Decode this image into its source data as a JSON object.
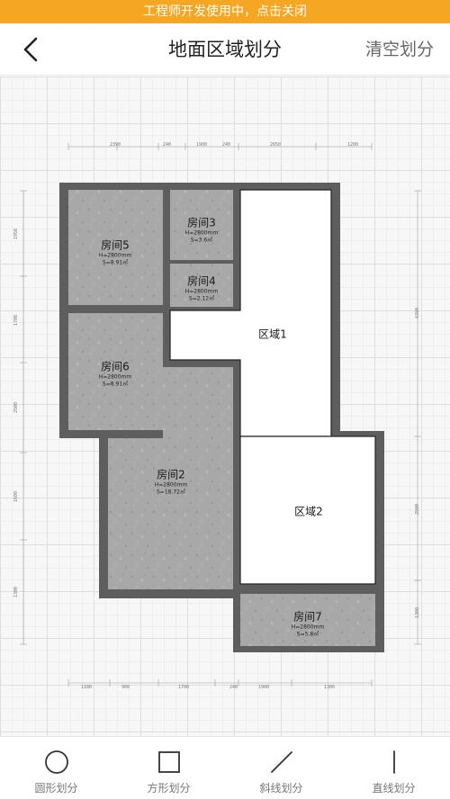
{
  "banner": {
    "text": "工程师开发使用中，点击关闭"
  },
  "header": {
    "title": "地面区域划分",
    "clear_label": "清空划分",
    "back_icon": "chevron-left-icon"
  },
  "plan": {
    "rooms": [
      {
        "id": "room5",
        "name": "房间5",
        "height": "H=2800mm",
        "area": "S=8.91㎡"
      },
      {
        "id": "room3",
        "name": "房间3",
        "height": "H=2800mm",
        "area": "S=3.6㎡"
      },
      {
        "id": "room4",
        "name": "房间4",
        "height": "H=2800mm",
        "area": "S=2.12㎡"
      },
      {
        "id": "room6",
        "name": "房间6",
        "height": "H=2800mm",
        "area": "S=8.91㎡"
      },
      {
        "id": "room2",
        "name": "房间2",
        "height": "H=2800mm",
        "area": "S=18.72㎡"
      },
      {
        "id": "room7",
        "name": "房间7",
        "height": "H=2800mm",
        "area": "S=5.8㎡"
      }
    ],
    "regions": [
      {
        "id": "region1",
        "name": "区域1"
      },
      {
        "id": "region2",
        "name": "区域2"
      }
    ],
    "dims_top": [
      "2390",
      "240",
      "1900",
      "240",
      "2650",
      "1200"
    ],
    "dims_bottom": [
      "1180",
      "900",
      "1700",
      "240",
      "1900",
      "1300"
    ],
    "dims_left": [
      "1950",
      "1700",
      "2500",
      "1600",
      "1300"
    ],
    "dims_right": [
      "4390",
      "2500",
      "1300"
    ],
    "colors": {
      "wall": "#606060",
      "floor": "#a9a9a9",
      "region": "#ffffff"
    }
  },
  "toolbar": {
    "tools": [
      {
        "label": "圆形划分",
        "icon": "circle-icon"
      },
      {
        "label": "方形划分",
        "icon": "square-icon"
      },
      {
        "label": "斜线划分",
        "icon": "diagonal-line-icon"
      },
      {
        "label": "直线划分",
        "icon": "vertical-line-icon"
      }
    ]
  }
}
